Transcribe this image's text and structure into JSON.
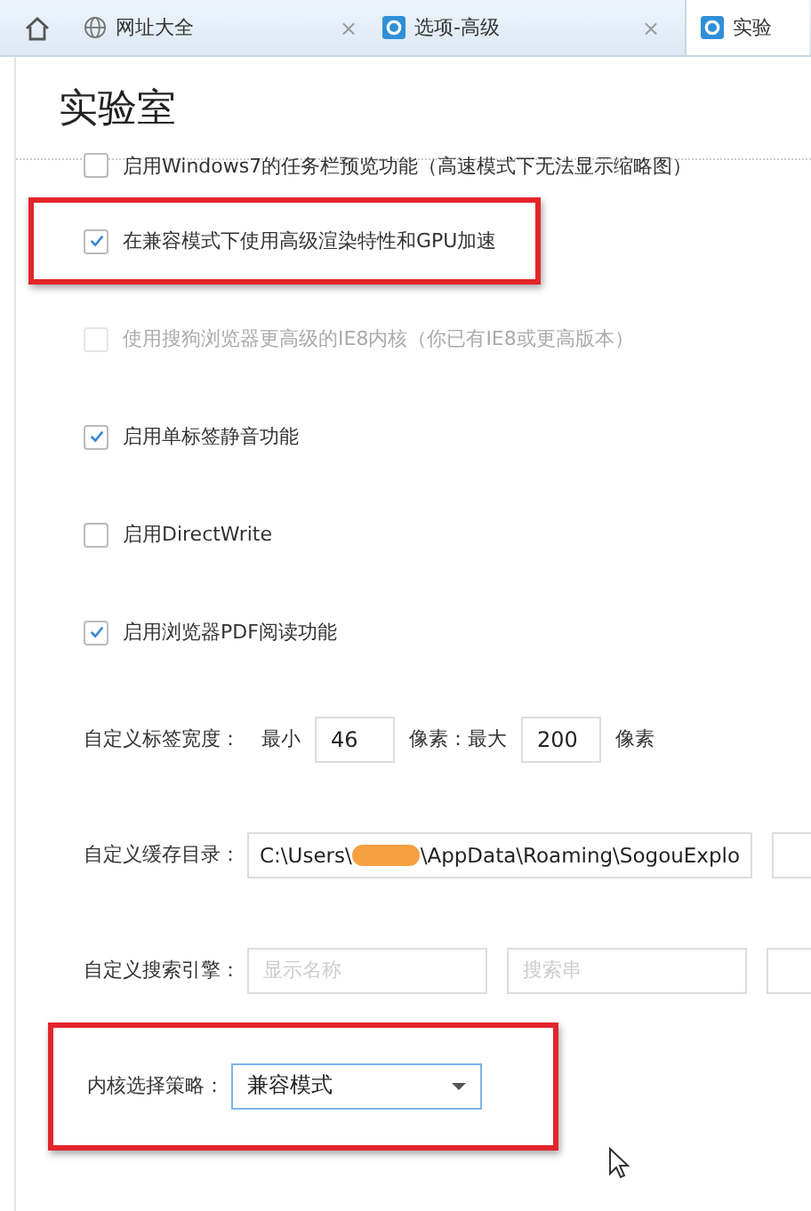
{
  "tabs": [
    {
      "label": "网址大全",
      "kind": "web",
      "close": "×",
      "selected": false
    },
    {
      "label": "选项-高级",
      "kind": "settings",
      "close": "×",
      "selected": false
    },
    {
      "label": "实验",
      "kind": "settings",
      "selected": true
    }
  ],
  "page_title": "实验室",
  "checkboxes": [
    {
      "label": "启用Windows7的任务栏预览功能（高速模式下无法显示缩略图）",
      "checked": false,
      "disabled": false,
      "highlighted": false
    },
    {
      "label": "在兼容模式下使用高级渲染特性和GPU加速",
      "checked": true,
      "disabled": false,
      "highlighted": true
    },
    {
      "label": "使用搜狗浏览器更高级的IE8内核（你已有IE8或更高版本）",
      "checked": false,
      "disabled": true,
      "highlighted": false
    },
    {
      "label": "启用单标签静音功能",
      "checked": true,
      "disabled": false,
      "highlighted": false
    },
    {
      "label": "启用DirectWrite",
      "checked": false,
      "disabled": false,
      "highlighted": false
    },
    {
      "label": "启用浏览器PDF阅读功能",
      "checked": true,
      "disabled": false,
      "highlighted": false
    }
  ],
  "settings": [
    {
      "kind": "range",
      "label": "自定义标签宽度：",
      "min_label": "最小",
      "min_value": "46",
      "max_label": "像素：最大",
      "max_value": "200",
      "unit": "像素",
      "highlighted": false
    },
    {
      "kind": "path",
      "label": "自定义缓存目录：",
      "value_start": "C:\\Users\\",
      "value_end": "\\AppData\\Roaming\\SogouExplo",
      "redacted": true,
      "extra_field": true,
      "highlighted": false
    },
    {
      "kind": "inputs",
      "label": "自定义搜索引擎：",
      "fields": [
        {
          "placeholder": "显示名称"
        },
        {
          "placeholder": "搜索串"
        }
      ],
      "extra_field": true,
      "highlighted": false
    },
    {
      "kind": "select",
      "label": "内核选择策略：",
      "value": "兼容模式",
      "highlighted": true
    }
  ]
}
